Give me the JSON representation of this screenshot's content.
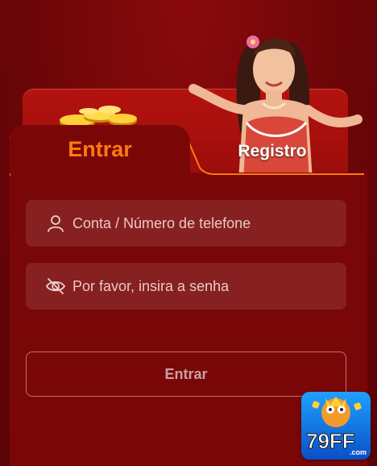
{
  "tabs": {
    "login_label": "Entrar",
    "register_label": "Registro"
  },
  "form": {
    "account_placeholder": "Conta / Número de telefone",
    "password_placeholder": "Por favor, insira a senha",
    "submit_label": "Entrar"
  },
  "brand": {
    "logo_text": "79FF",
    "logo_suffix": ".com"
  },
  "icons": {
    "account": "user-icon",
    "password": "eye-off-icon"
  },
  "colors": {
    "accent": "#ff7a10",
    "background": "#7a0707"
  }
}
